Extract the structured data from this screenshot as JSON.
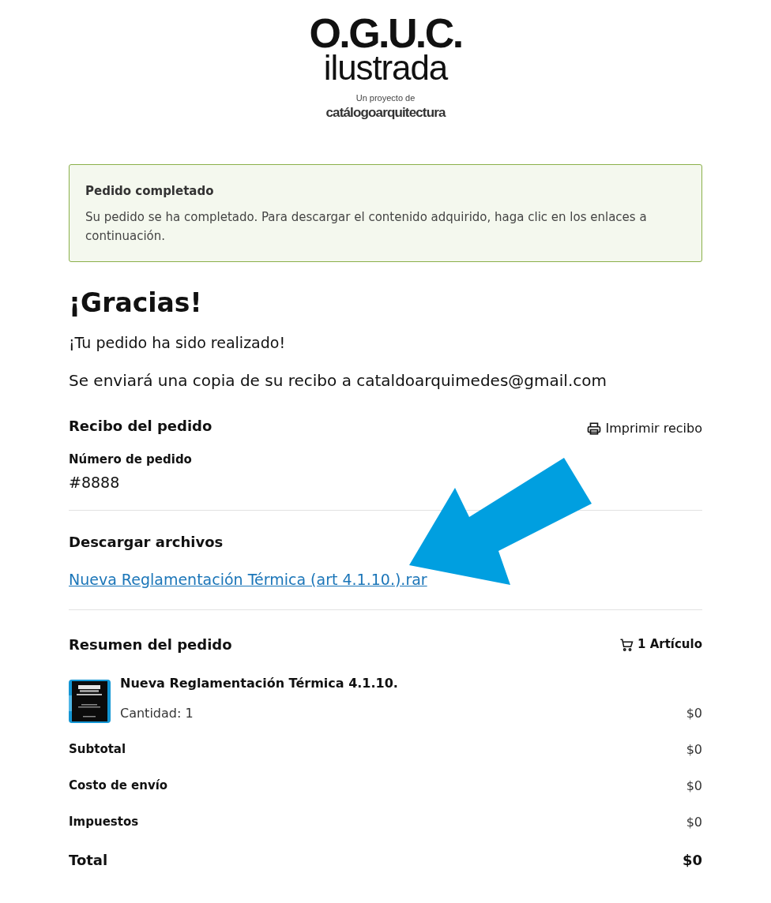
{
  "logo": {
    "title": "O.G.U.C.",
    "subtitle": "ilustrada",
    "tagline": "Un proyecto de",
    "brand": "catálogoarquitectura"
  },
  "notice": {
    "title": "Pedido completado",
    "message": "Su pedido se ha completado. Para descargar el contenido adquirido, haga clic en los enlaces a continuación."
  },
  "heading": "¡Gracias!",
  "confirmation": "¡Tu pedido ha sido realizado!",
  "email_note": "Se enviará una copia de su recibo a cataldoarquimedes@gmail.com",
  "receipt": {
    "title": "Recibo del pedido",
    "print_label": "Imprimir recibo",
    "number_label": "Número de pedido",
    "number": "#8888"
  },
  "downloads": {
    "title": "Descargar archivos",
    "files": [
      "Nueva Reglamentación Térmica (art 4.1.10.).rar"
    ]
  },
  "summary": {
    "title": "Resumen del pedido",
    "count": "1 Artículo",
    "items": [
      {
        "kind": "picture",
        "name": "Nueva Reglamentación Térmica 4.1.10.",
        "quantity": "Cantidad: 1",
        "price": "$0"
      }
    ],
    "lines": [
      {
        "label": "Subtotal",
        "value": "$0",
        "total": false
      },
      {
        "label": "Costo de envío",
        "value": "$0",
        "total": false
      },
      {
        "label": "Impuestos",
        "value": "$0",
        "total": false
      },
      {
        "label": "Total",
        "value": "$0",
        "total": true
      }
    ]
  }
}
